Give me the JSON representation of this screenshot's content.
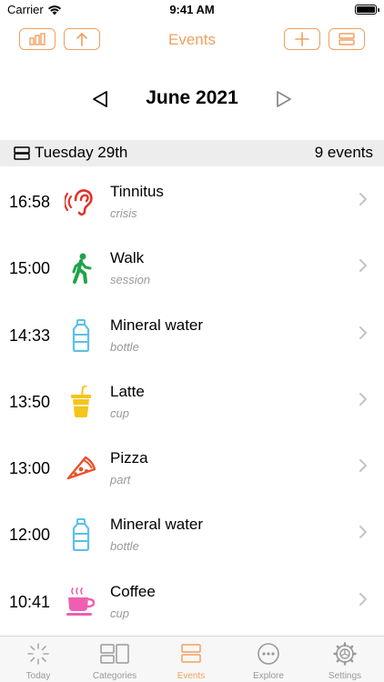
{
  "status_bar": {
    "carrier": "Carrier",
    "time": "9:41 AM"
  },
  "nav": {
    "title": "Events"
  },
  "month_selector": {
    "title": "June 2021"
  },
  "day": {
    "label": "Tuesday 29th",
    "count": "9 events"
  },
  "events": [
    {
      "time": "16:58",
      "name": "Tinnitus",
      "detail": "crisis",
      "icon": "ear-icon"
    },
    {
      "time": "15:00",
      "name": "Walk",
      "detail": "session",
      "icon": "walking-person-icon"
    },
    {
      "time": "14:33",
      "name": "Mineral water",
      "detail": "bottle",
      "icon": "water-bottle-icon"
    },
    {
      "time": "13:50",
      "name": "Latte",
      "detail": "cup",
      "icon": "latte-cup-icon"
    },
    {
      "time": "13:00",
      "name": "Pizza",
      "detail": "part",
      "icon": "pizza-slice-icon"
    },
    {
      "time": "12:00",
      "name": "Mineral water",
      "detail": "bottle",
      "icon": "water-bottle-icon"
    },
    {
      "time": "10:41",
      "name": "Coffee",
      "detail": "cup",
      "icon": "coffee-cup-icon"
    }
  ],
  "tabs": [
    {
      "label": "Today",
      "icon": "sun-icon",
      "active": false
    },
    {
      "label": "Categories",
      "icon": "categories-icon",
      "active": false
    },
    {
      "label": "Events",
      "icon": "events-list-icon",
      "active": true
    },
    {
      "label": "Explore",
      "icon": "ellipsis-circle-icon",
      "active": false
    },
    {
      "label": "Settings",
      "icon": "settings-gear-icon",
      "active": false
    }
  ],
  "colors": {
    "accent": "#f0a060",
    "ear": "#e0342a",
    "walk": "#1fa34a",
    "water": "#5bc0e8",
    "latte": "#f5c518",
    "pizza": "#e8542a",
    "coffee": "#ee5fb3",
    "inactive": "#999999"
  }
}
